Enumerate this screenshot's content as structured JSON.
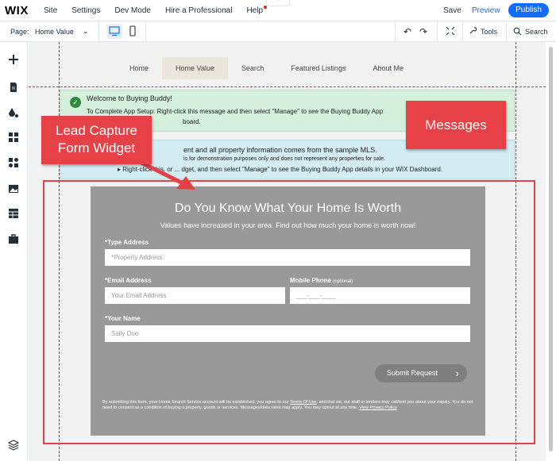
{
  "topbar": {
    "logo": "WIX",
    "menu": [
      "Site",
      "Settings",
      "Dev Mode",
      "Hire a Professional",
      "Help"
    ],
    "save": "Save",
    "preview": "Preview",
    "publish": "Publish"
  },
  "subbar": {
    "page_label": "Page:",
    "page_value": "Home Value",
    "tools": "Tools",
    "search": "Search"
  },
  "site_nav": [
    "Home",
    "Home Value",
    "Search",
    "Featured Listings",
    "About Me"
  ],
  "messages": {
    "green_title": "Welcome to Buying Buddy!",
    "green_line1": "To Complete App Setup:  Right-click this message and then select \"Manage\" to see the Buying Buddy App",
    "green_line2": "board.",
    "blue_line1": "ent and all property information comes from the sample MLS.",
    "blue_line2": "is for demonstration purposes only and does not represent any properties for sale.",
    "blue_line3": "Right-click this, or ... dget, and then select \"Manage\" to see the Buying Buddy App details in your WIX Dashboard."
  },
  "form": {
    "title": "Do You Know What Your Home Is Worth",
    "subtitle": "Values have increased in your area. Find out how much your home is worth now!",
    "address_label": "*Type Address",
    "address_placeholder": "*Property Address",
    "email_label": "*Email Address",
    "email_placeholder": "Your Email Address",
    "phone_label": "Mobile Phone",
    "phone_optional": "(optional)",
    "phone_placeholder": "___-___-____",
    "name_label": "*Your Name",
    "name_placeholder": "Sally Doe",
    "submit": "Submit Request",
    "disclaimer_1": "By submitting this form, your Home Search Service account will be established, you agree to our ",
    "terms": "Terms Of Use",
    "disclaimer_2": ", and that we, our staff or lenders may call/text you about your inquiry. You do not need to consent as a condition of buying a property, goods or services. Messages/data rates may apply. You may optout at any time. ",
    "privacy": "View Privacy Policy"
  },
  "callouts": {
    "lead": "Lead Capture Form Widget",
    "messages": "Messages"
  },
  "colors": {
    "accent": "#116dff",
    "callout": "#e54146",
    "form_bg": "#999999"
  }
}
